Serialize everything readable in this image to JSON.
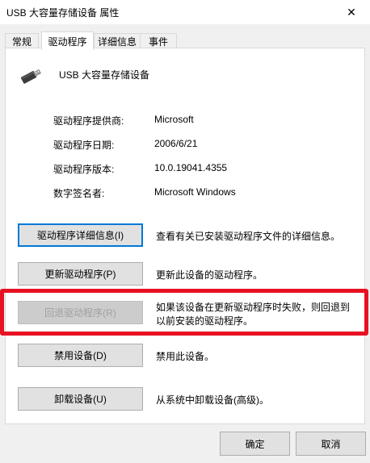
{
  "window": {
    "title": "USB 大容量存储设备 属性",
    "close_glyph": "✕"
  },
  "tabs": [
    {
      "label": "常规"
    },
    {
      "label": "驱动程序"
    },
    {
      "label": "详细信息"
    },
    {
      "label": "事件"
    }
  ],
  "device": {
    "name": "USB 大容量存储设备",
    "icon": "usb-drive-icon"
  },
  "driver_info": [
    {
      "label": "驱动程序提供商:",
      "value": "Microsoft"
    },
    {
      "label": "驱动程序日期:",
      "value": "2006/6/21"
    },
    {
      "label": "驱动程序版本:",
      "value": "10.0.19041.4355"
    },
    {
      "label": "数字签名者:",
      "value": "Microsoft Windows"
    }
  ],
  "actions": [
    {
      "button": "驱动程序详细信息(I)",
      "desc": "查看有关已安装驱动程序文件的详细信息。"
    },
    {
      "button": "更新驱动程序(P)",
      "desc": "更新此设备的驱动程序。"
    },
    {
      "button": "回退驱动程序(R)",
      "desc": "如果该设备在更新驱动程序时失败，则回退到以前安装的驱动程序。"
    },
    {
      "button": "禁用设备(D)",
      "desc": "禁用此设备。"
    },
    {
      "button": "卸载设备(U)",
      "desc": "从系统中卸载设备(高级)。"
    }
  ],
  "dialog": {
    "ok": "确定",
    "cancel": "取消"
  },
  "colors": {
    "highlight": "#e81123",
    "focus": "#0078d7"
  }
}
